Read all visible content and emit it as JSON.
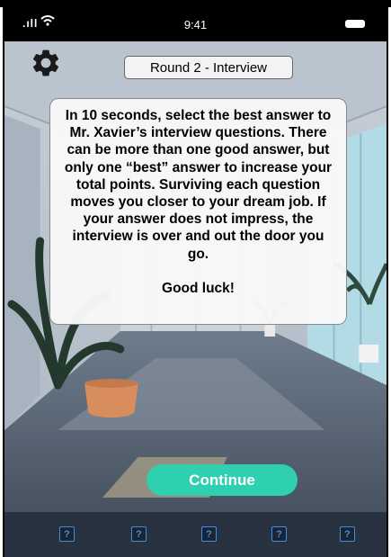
{
  "status_bar": {
    "time": "9:41"
  },
  "round_label": "Round 2 - Interview",
  "instructions": {
    "body": "In 10 seconds, select the best answer to Mr. Xavier’s interview questions. There can be more than one good answer, but only one “best” answer to increase your total points. Surviving each question moves you closer to your dream job. If your answer does not impress, the interview is over and out the door you go.",
    "closing": "Good luck!"
  },
  "continue_label": "Continue",
  "bottom_bar": {
    "slots": [
      "?",
      "?",
      "?",
      "?",
      "?"
    ]
  },
  "icons": {
    "settings": "gear-icon",
    "signal": "cellular-signal-icon",
    "wifi": "wifi-icon",
    "battery": "battery-icon",
    "slot": "question-mark-icon"
  },
  "colors": {
    "continue_button": "#2fd0b0",
    "slot_accent": "#3d8fe6",
    "bottom_bar": "#283240"
  }
}
